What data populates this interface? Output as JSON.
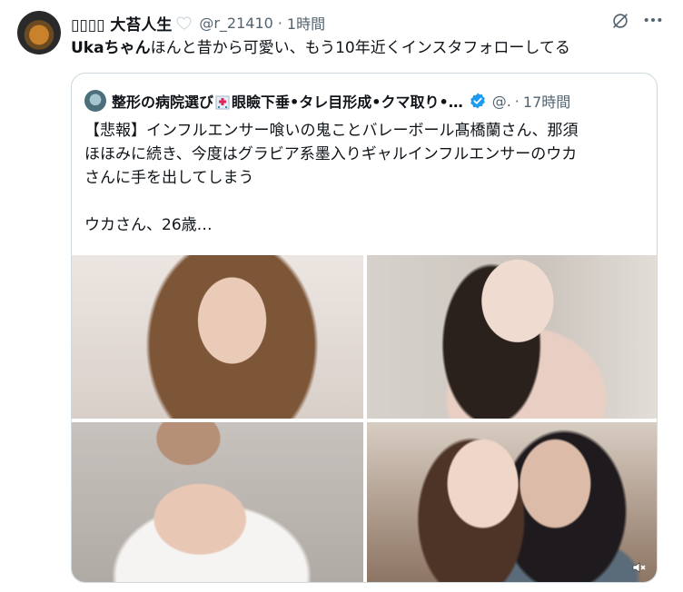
{
  "author": {
    "name": "▯▯▯▯ 大苔人生",
    "handle": "@r_21410",
    "separator": "·",
    "time": "1時間"
  },
  "tweet": {
    "bold": "Ukaちゃん",
    "rest": "ほんと昔から可愛い、もう10年近くインスタフォローしてる"
  },
  "quote": {
    "name_part1": "整形の病院選び",
    "name_part2": "眼瞼下垂•タレ目形成•クマ取り•…",
    "handle": "@.",
    "separator": "·",
    "time": "17時間",
    "lines": [
      "【悲報】インフルエンサー喰いの鬼ことバレーボール髙橋蘭さん、那須",
      "ほほみに続き、今度はグラビア系墨入りギャルインフルエンサーのウカ",
      "さんに手を出してしまう",
      "ウカさん、26歳…"
    ]
  },
  "colors": {
    "text": "#0f1419",
    "secondary": "#536471",
    "border": "#cfd9de",
    "verified": "#1d9bf0"
  },
  "icons": [
    "avatar",
    "heart-icon",
    "grok-icon",
    "more-icon",
    "hospital-icon",
    "verified-icon",
    "mute-icon"
  ]
}
